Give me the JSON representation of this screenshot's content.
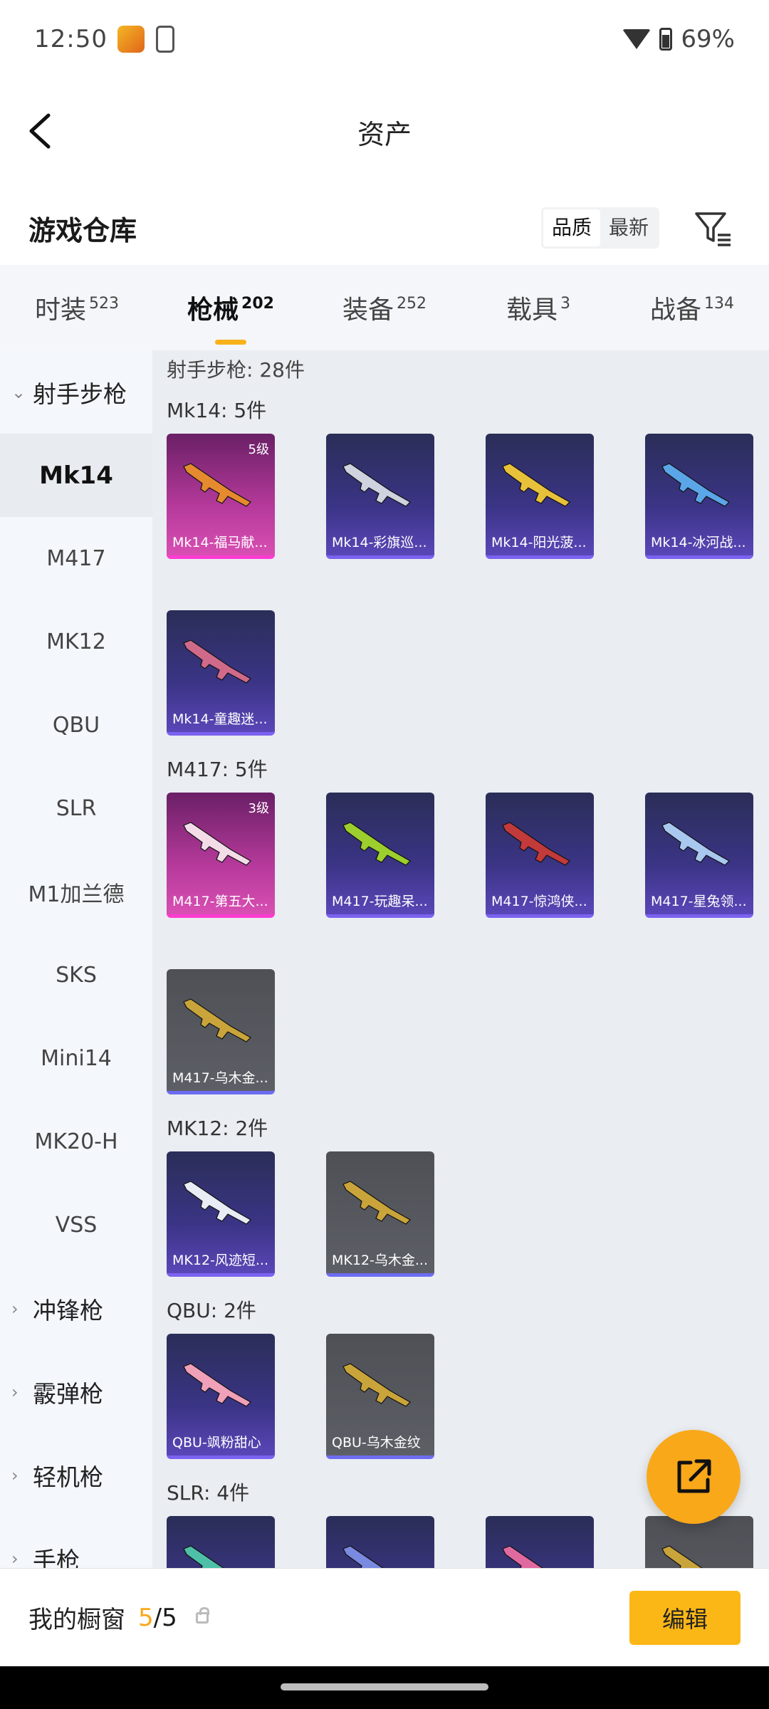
{
  "status_bar": {
    "time": "12:50",
    "battery": "69%"
  },
  "header": {
    "title": "资产"
  },
  "warehouse": {
    "title": "游戏仓库",
    "sort_options": [
      "品质",
      "最新"
    ]
  },
  "tabs": [
    {
      "label": "时装",
      "count": "523"
    },
    {
      "label": "枪械",
      "count": "202"
    },
    {
      "label": "装备",
      "count": "252"
    },
    {
      "label": "载具",
      "count": "3"
    },
    {
      "label": "战备",
      "count": "134"
    }
  ],
  "sidebar": {
    "category": "射手步枪",
    "items": [
      "Mk14",
      "M417",
      "MK12",
      "QBU",
      "SLR",
      "M1加兰德",
      "SKS",
      "Mini14",
      "MK20-H",
      "VSS"
    ],
    "other_categories": [
      "冲锋枪",
      "霰弹枪",
      "轻机枪",
      "手枪"
    ]
  },
  "main": {
    "section_title": "射手步枪: 28件",
    "groups": [
      {
        "title": "Mk14: 5件",
        "cards": [
          {
            "name": "Mk14-福马献...",
            "level": "5级",
            "style": "pink",
            "gun_color": "#e58a2e"
          },
          {
            "name": "Mk14-彩旗巡...",
            "level": "",
            "style": "purple",
            "gun_color": "#cfd3df"
          },
          {
            "name": "Mk14-阳光菠...",
            "level": "",
            "style": "purple",
            "gun_color": "#e8c13a"
          },
          {
            "name": "Mk14-冰河战...",
            "level": "",
            "style": "purple",
            "gun_color": "#5aa6e8"
          },
          {
            "name": "Mk14-童趣迷...",
            "level": "",
            "style": "purple",
            "gun_color": "#d06a8a"
          }
        ]
      },
      {
        "title": "M417: 5件",
        "cards": [
          {
            "name": "M417-第五大...",
            "level": "3级",
            "style": "pink",
            "gun_color": "#f3dce8"
          },
          {
            "name": "M417-玩趣呆...",
            "level": "",
            "style": "purple",
            "gun_color": "#9ccf2e"
          },
          {
            "name": "M417-惊鸿侠...",
            "level": "",
            "style": "purple",
            "gun_color": "#c23a3a"
          },
          {
            "name": "M417-星兔领...",
            "level": "",
            "style": "purple",
            "gun_color": "#a9c8f0"
          },
          {
            "name": "M417-乌木金...",
            "level": "",
            "style": "gray",
            "gun_color": "#c9a43a"
          }
        ]
      },
      {
        "title": "MK12: 2件",
        "cards": [
          {
            "name": "MK12-风迹短...",
            "level": "",
            "style": "purple",
            "gun_color": "#e8ecf4"
          },
          {
            "name": "MK12-乌木金...",
            "level": "",
            "style": "gray",
            "gun_color": "#c9a43a"
          }
        ]
      },
      {
        "title": "QBU: 2件",
        "cards": [
          {
            "name": "QBU-飒粉甜心",
            "level": "",
            "style": "purple",
            "gun_color": "#f0a0b8"
          },
          {
            "name": "QBU-乌木金纹",
            "level": "",
            "style": "gray",
            "gun_color": "#c9a43a"
          }
        ]
      },
      {
        "title": "SLR: 4件",
        "cards": [
          {
            "name": "",
            "level": "",
            "style": "purple",
            "gun_color": "#4ec0a8"
          },
          {
            "name": "",
            "level": "",
            "style": "purple",
            "gun_color": "#7a8ae0"
          },
          {
            "name": "",
            "level": "",
            "style": "purple",
            "gun_color": "#e06aa0"
          },
          {
            "name": "",
            "level": "",
            "style": "gray",
            "gun_color": "#c9a43a"
          }
        ]
      }
    ]
  },
  "bottom_bar": {
    "label": "我的橱窗",
    "current": "5",
    "total": "/5",
    "edit_label": "编辑"
  },
  "colors": {
    "accent": "#f9a81a",
    "pink_card": "#d84fb3",
    "purple_card": "#3b3486"
  }
}
